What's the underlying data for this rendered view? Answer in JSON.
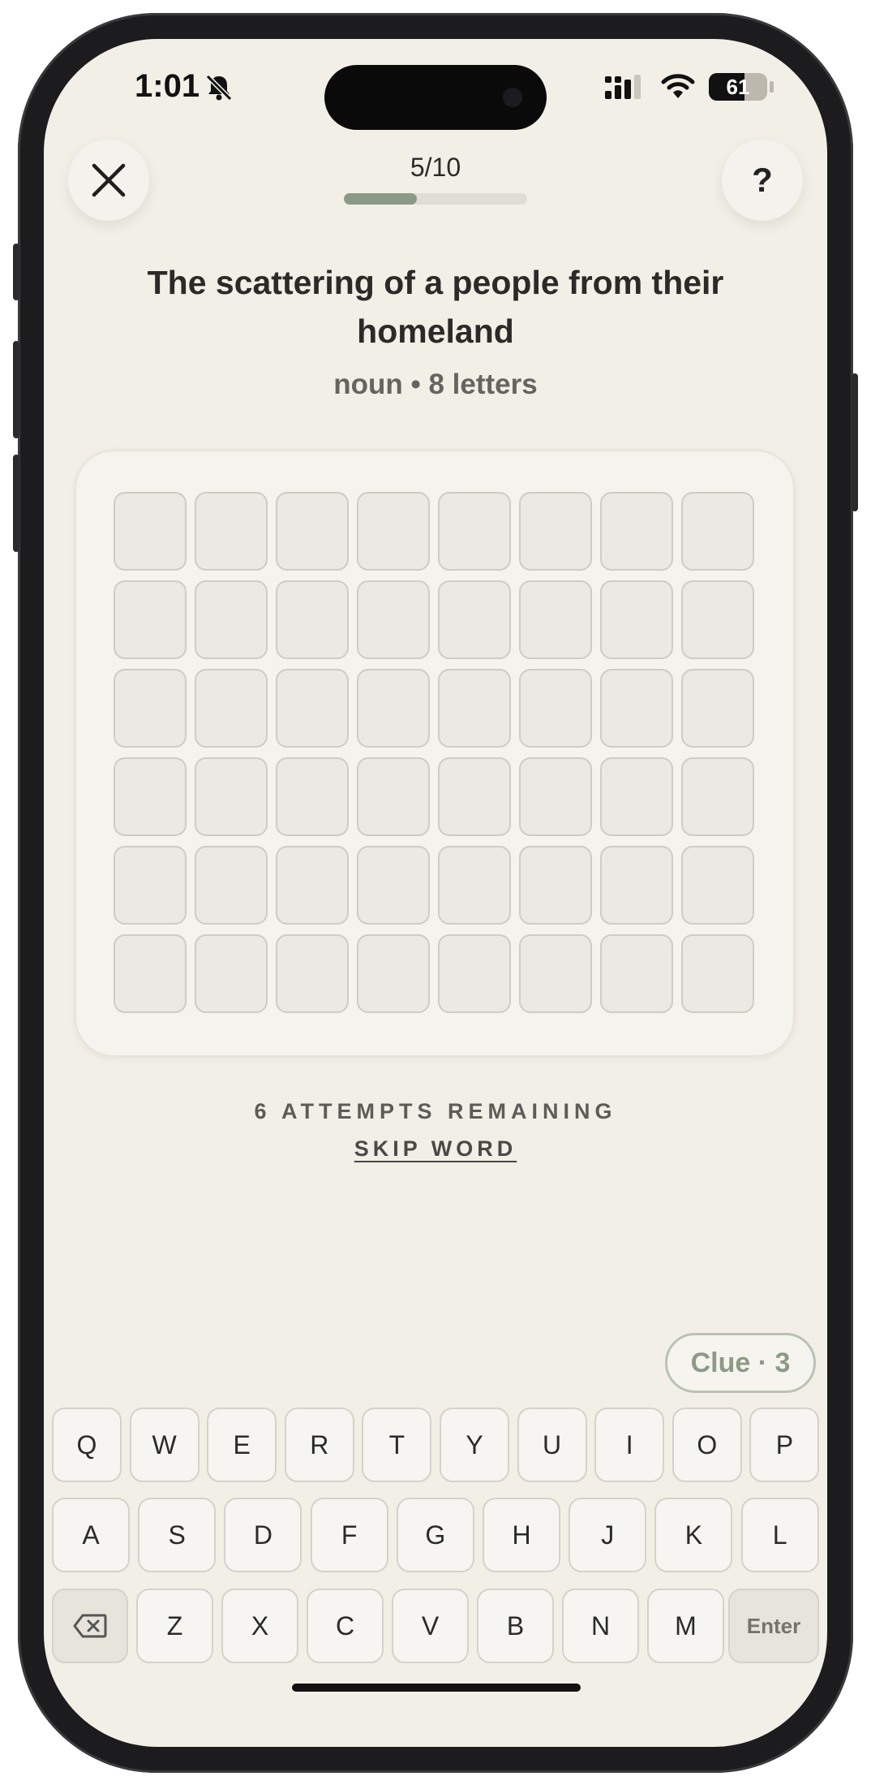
{
  "status": {
    "time": "1:01",
    "battery": "61"
  },
  "header": {
    "progress_label": "5/10",
    "progress_fraction": 0.4
  },
  "clue": {
    "text": "The scattering of a people from their homeland",
    "meta": "noun • 8 letters"
  },
  "board": {
    "rows": 6,
    "cols": 8
  },
  "attempts_label": "6 ATTEMPTS REMAINING",
  "skip_label": "SKIP WORD",
  "clue_button_label": "Clue · 3",
  "keyboard": {
    "row1": [
      "Q",
      "W",
      "E",
      "R",
      "T",
      "Y",
      "U",
      "I",
      "O",
      "P"
    ],
    "row2": [
      "A",
      "S",
      "D",
      "F",
      "G",
      "H",
      "J",
      "K",
      "L"
    ],
    "row3": [
      "Z",
      "X",
      "C",
      "V",
      "B",
      "N",
      "M"
    ],
    "enter_label": "Enter"
  },
  "colors": {
    "background": "#f2efe6",
    "accent": "#8b9a86"
  },
  "icons": {
    "close": "close-icon",
    "help": "question-icon",
    "backspace": "backspace-icon"
  }
}
